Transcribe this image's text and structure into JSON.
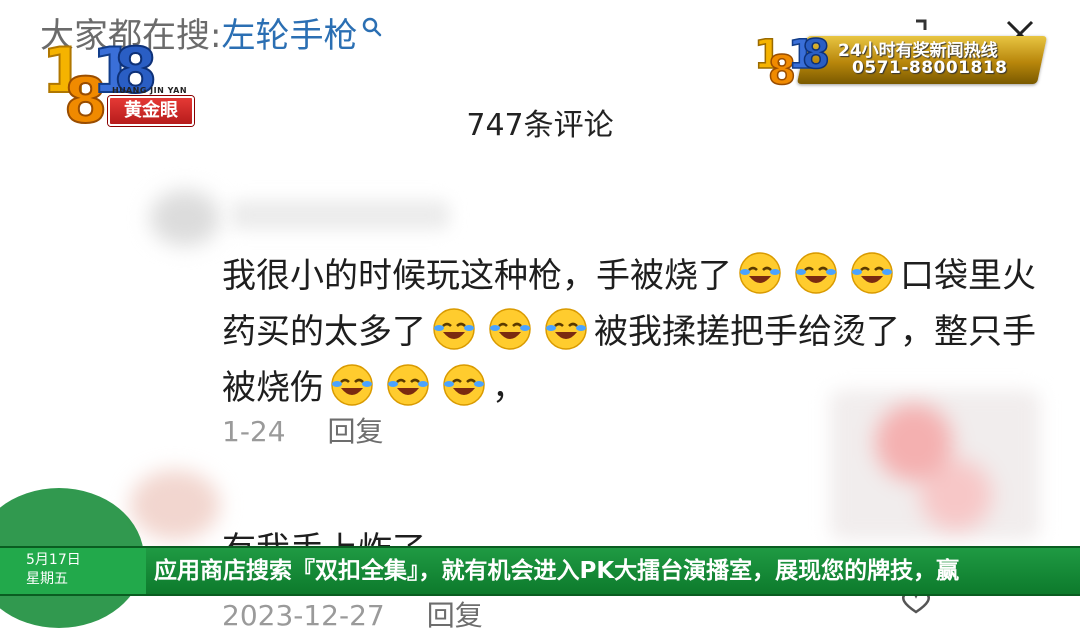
{
  "search": {
    "prefix": "大家都在搜:",
    "query": "左轮手枪"
  },
  "logo": {
    "number": "1818",
    "pinyin": "HUANG JIN YAN",
    "name": "黄金眼"
  },
  "hotline": {
    "title": "24小时有奖新闻热线",
    "number": "0571-88001818"
  },
  "comments_header": "747条评论",
  "comment1": {
    "part1": "我很小的时候玩这种枪，手被烧了",
    "part2": "口袋里火药买的太多了",
    "part3": "被我揉搓把手给烫了，整只手被烧伤",
    "part4": "，",
    "date": "1-24",
    "reply_label": "回复"
  },
  "comment2": {
    "text": "有我手上炸了",
    "date": "2023-12-27",
    "reply_label": "回复"
  },
  "ticker": {
    "date": "5月17日",
    "weekday": "星期五",
    "text": "应用商店搜索『双扣全集』，就有机会进入PK大擂台演播室，展现您的牌技，赢"
  },
  "colors": {
    "ticker_green": "#1f9a43",
    "query_blue": "#2b6fb3",
    "hotline_gold": "#d4a017",
    "logo_red": "#e53935"
  },
  "icons": [
    "search-icon",
    "close-icon",
    "fullscreen-icon",
    "laughing-emoji-icon",
    "heart-icon"
  ]
}
